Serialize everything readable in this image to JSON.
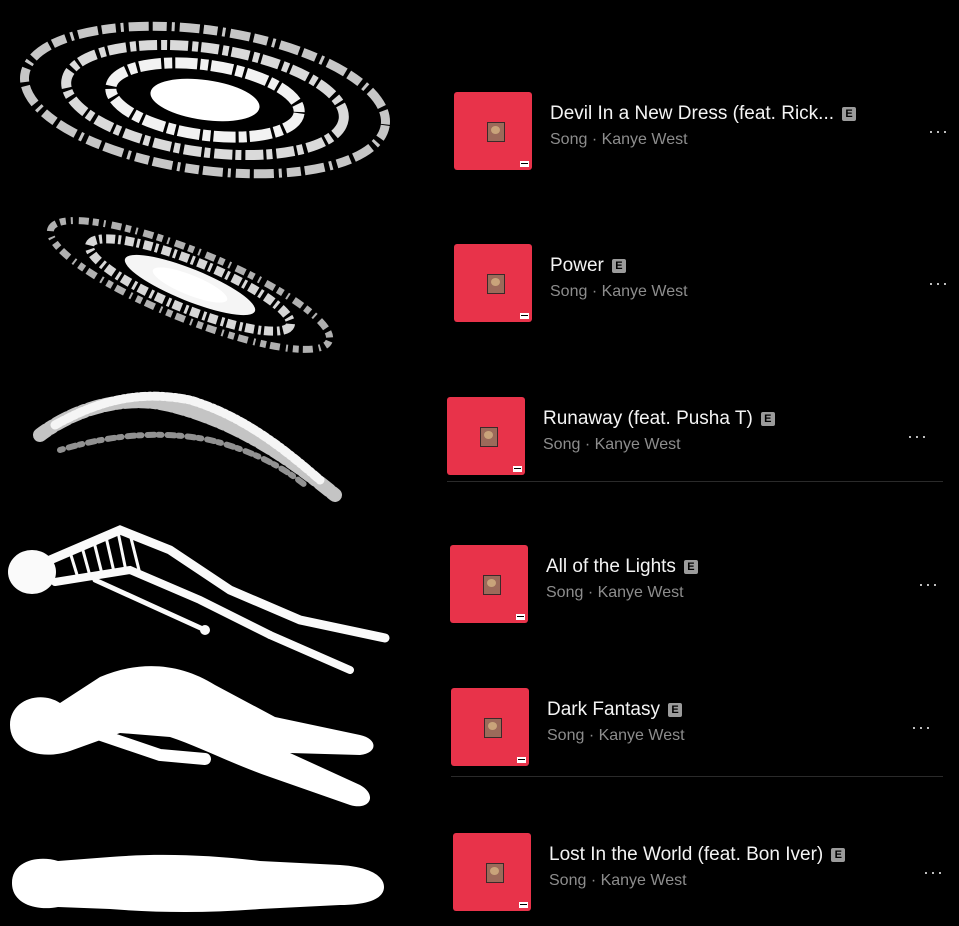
{
  "songs": [
    {
      "title": "Devil In a New Dress (feat. Rick...",
      "explicit_badge": "E",
      "subtitle": "Song · Kanye West",
      "more_label": "···"
    },
    {
      "title": "Power",
      "explicit_badge": "E",
      "subtitle": "Song · Kanye West",
      "more_label": "···"
    },
    {
      "title": "Runaway (feat. Pusha T)",
      "explicit_badge": "E",
      "subtitle": "Song · Kanye West",
      "more_label": "···"
    },
    {
      "title": "All of the Lights",
      "explicit_badge": "E",
      "subtitle": "Song · Kanye West",
      "more_label": "···"
    },
    {
      "title": "Dark Fantasy",
      "explicit_badge": "E",
      "subtitle": "Song · Kanye West",
      "more_label": "···"
    },
    {
      "title": "Lost In the World (feat. Bon Iver)",
      "explicit_badge": "E",
      "subtitle": "Song · Kanye West",
      "more_label": "···"
    }
  ],
  "colors": {
    "background": "#000000",
    "cover": "#e8334a",
    "title_text": "#f4f4f4",
    "subtitle_text": "#8d8d8d",
    "badge": "#9b9b9b"
  },
  "illustrations": [
    "spiral-galaxy-icon",
    "tilted-galaxy-icon",
    "dissolving-galaxy-icon",
    "floating-skeleton-icon",
    "floating-body-silhouette-icon",
    "lying-body-silhouette-icon"
  ]
}
